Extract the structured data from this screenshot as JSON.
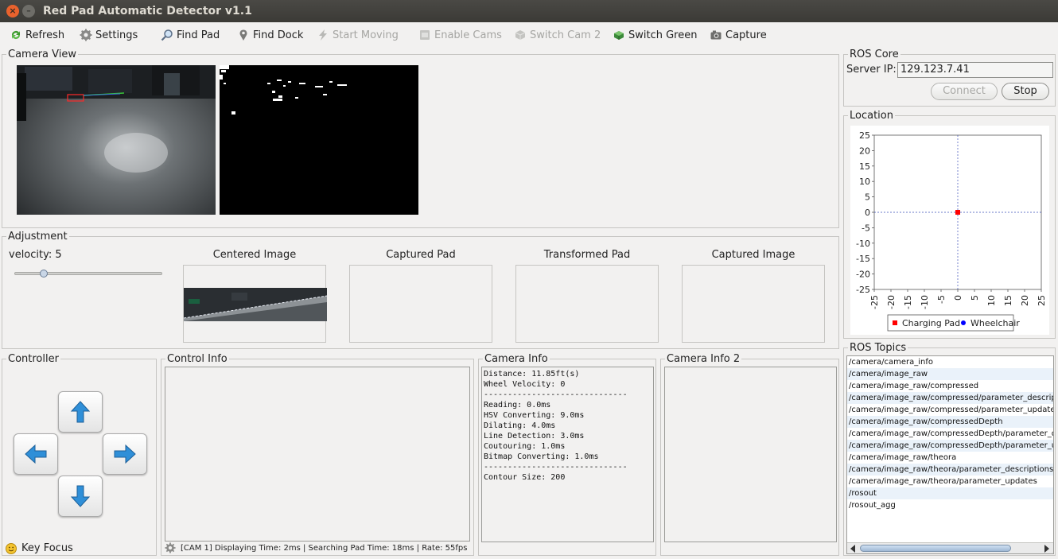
{
  "window": {
    "title": "Red Pad Automatic Detector v1.1"
  },
  "toolbar": {
    "items": [
      {
        "label": "Refresh",
        "icon": "refresh-icon",
        "enabled": true
      },
      {
        "label": "Settings",
        "icon": "gear-icon",
        "enabled": true
      },
      {
        "label": "Find Pad",
        "icon": "magnifier-icon",
        "enabled": true
      },
      {
        "label": "Find Dock",
        "icon": "pin-icon",
        "enabled": true
      },
      {
        "label": "Start Moving",
        "icon": "lightning-icon",
        "enabled": false
      },
      {
        "label": "Enable Cams",
        "icon": "cam-enable-icon",
        "enabled": false
      },
      {
        "label": "Switch Cam 2",
        "icon": "cam-switch-icon",
        "enabled": false
      },
      {
        "label": "Switch Green",
        "icon": "green-cube-icon",
        "enabled": true
      },
      {
        "label": "Capture",
        "icon": "camera-icon",
        "enabled": true
      }
    ]
  },
  "camera_view": {
    "title": "Camera View"
  },
  "adjustment": {
    "title": "Adjustment",
    "velocity_label": "velocity: 5",
    "velocity_level": 0.2,
    "boxes": [
      "Centered Image",
      "Captured Pad",
      "Transformed Pad",
      "Captured Image"
    ]
  },
  "controller": {
    "title": "Controller",
    "key_focus": "Key Focus"
  },
  "control_info": {
    "title": "Control Info",
    "status": "[CAM 1] Displaying Time: 2ms | Searching Pad Time: 18ms | Rate: 55fps"
  },
  "camera_info": {
    "title": "Camera Info",
    "text": "Distance: 11.85ft(s)\nWheel Velocity: 0\n------------------------------\nReading: 0.0ms\nHSV Converting: 9.0ms\nDilating: 4.0ms\nLine Detection: 3.0ms\nCoutouring: 1.0ms\nBitmap Converting: 1.0ms\n------------------------------\nContour Size: 200"
  },
  "camera_info_2": {
    "title": "Camera Info 2"
  },
  "ros_core": {
    "title": "ROS Core",
    "server_ip_label": "Server IP:",
    "server_ip": "129.123.7.41",
    "connect_label": "Connect",
    "stop_label": "Stop"
  },
  "location": {
    "title": "Location",
    "legend": [
      {
        "label": "Charging Pad",
        "color": "#ff0000",
        "marker": "square"
      },
      {
        "label": "Wheelchair",
        "color": "#0000ff",
        "marker": "circle"
      }
    ]
  },
  "chart_data": {
    "type": "scatter",
    "xlim": [
      -25,
      25
    ],
    "ylim": [
      -25,
      25
    ],
    "x_ticks": [
      -25,
      -20,
      -15,
      -10,
      -5,
      0,
      5,
      10,
      15,
      20,
      25
    ],
    "y_ticks": [
      25,
      20,
      15,
      10,
      5,
      0,
      -5,
      -10,
      -15,
      -20,
      -25
    ],
    "series": [
      {
        "name": "Charging Pad",
        "color": "#ff0000",
        "points": [
          [
            0,
            0
          ]
        ]
      },
      {
        "name": "Wheelchair",
        "color": "#0000ff",
        "points": []
      }
    ],
    "legend_position": "bottom"
  },
  "ros_topics": {
    "title": "ROS Topics",
    "items": [
      "/camera/camera_info",
      "/camera/image_raw",
      "/camera/image_raw/compressed",
      "/camera/image_raw/compressed/parameter_descript",
      "/camera/image_raw/compressed/parameter_updates",
      "/camera/image_raw/compressedDepth",
      "/camera/image_raw/compressedDepth/parameter_de",
      "/camera/image_raw/compressedDepth/parameter_up",
      "/camera/image_raw/theora",
      "/camera/image_raw/theora/parameter_descriptions",
      "/camera/image_raw/theora/parameter_updates",
      "/rosout",
      "/rosout_agg"
    ]
  }
}
